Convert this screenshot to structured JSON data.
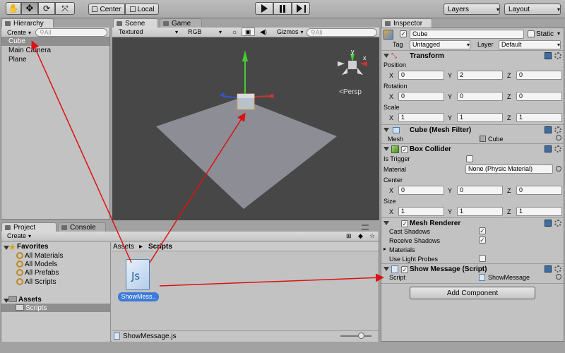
{
  "toolbar": {
    "center_label": "Center",
    "local_label": "Local",
    "layers_label": "Layers",
    "layout_label": "Layout"
  },
  "hierarchy": {
    "tab": "Hierarchy",
    "create": "Create",
    "search_placeholder": "All",
    "items": [
      "Cube",
      "Main Camera",
      "Plane"
    ]
  },
  "scene": {
    "tab_scene": "Scene",
    "tab_game": "Game",
    "render_mode": "Textured",
    "color_mode": "RGB",
    "gizmos": "Gizmos",
    "search_placeholder": "All",
    "persp": "Persp",
    "axis_y": "y",
    "axis_x": "x"
  },
  "project": {
    "tab_project": "Project",
    "tab_console": "Console",
    "create": "Create",
    "favorites_label": "Favorites",
    "favorites": [
      "All Materials",
      "All Models",
      "All Prefabs",
      "All Scripts"
    ],
    "assets_label": "Assets",
    "assets_children": [
      "Scripts"
    ],
    "breadcrumb": [
      "Assets",
      "Scripts"
    ],
    "file_name": "ShowMess..",
    "file_icon_text": "Js",
    "status_file": "ShowMessage.js",
    "zoom_level": 0.65
  },
  "inspector": {
    "tab": "Inspector",
    "object_name": "Cube",
    "static_label": "Static",
    "tag_label": "Tag",
    "tag_value": "Untagged",
    "layer_label": "Layer",
    "layer_value": "Default",
    "transform": {
      "title": "Transform",
      "position_label": "Position",
      "rotation_label": "Rotation",
      "scale_label": "Scale",
      "position": {
        "x": "0",
        "y": "2",
        "z": "0"
      },
      "rotation": {
        "x": "0",
        "y": "0",
        "z": "0"
      },
      "scale": {
        "x": "1",
        "y": "1",
        "z": "1"
      }
    },
    "mesh_filter": {
      "title": "Cube (Mesh Filter)",
      "mesh_label": "Mesh",
      "mesh_value": "Cube"
    },
    "box_collider": {
      "title": "Box Collider",
      "is_trigger_label": "Is Trigger",
      "material_label": "Material",
      "material_value": "None (Physic Material)",
      "center_label": "Center",
      "center": {
        "x": "0",
        "y": "0",
        "z": "0"
      },
      "size_label": "Size",
      "size": {
        "x": "1",
        "y": "1",
        "z": "1"
      }
    },
    "mesh_renderer": {
      "title": "Mesh Renderer",
      "cast_shadows": "Cast Shadows",
      "receive_shadows": "Receive Shadows",
      "materials": "Materials",
      "use_light_probes": "Use Light Probes"
    },
    "show_message": {
      "title": "Show Message (Script)",
      "script_label": "Script",
      "script_value": "ShowMessage"
    },
    "add_component": "Add Component"
  },
  "axis_labels": {
    "x": "X",
    "y": "Y",
    "z": "Z"
  },
  "colors": {
    "arrow": "#dd1111",
    "selection": "#3d7bd9",
    "scene_bg": "#474747",
    "plane": "#8d8d96"
  }
}
